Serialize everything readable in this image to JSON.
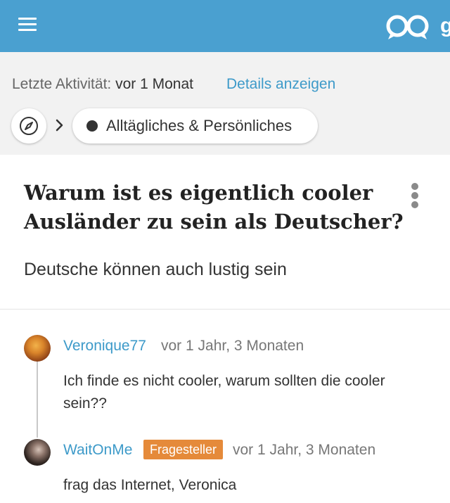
{
  "icons": {
    "menu": "hamburger-icon",
    "logo": "gutefrage-logo",
    "compass": "compass-icon",
    "separator": "chevron-right-icon",
    "category_dot": "dot-icon",
    "more": "more-vertical-icon"
  },
  "colors": {
    "header": "#4aa0d0",
    "link": "#3d9ac9",
    "badge": "#e58a3a",
    "meta_background": "#f2f2f2"
  },
  "header": {
    "logo_text": "g"
  },
  "meta": {
    "activity_label": "Letzte Aktivität:",
    "activity_value": "vor 1 Monat",
    "details_link": "Details anzeigen"
  },
  "breadcrumb": {
    "category": "Alltägliches & Persönliches"
  },
  "question": {
    "title": "Warum ist es eigentlich cooler Ausländer zu sein als Deutscher?",
    "body": "Deutsche können auch lustig sein"
  },
  "comments": [
    {
      "author": "Veronique77",
      "time": "vor 1 Jahr, 3 Monaten",
      "text": "Ich finde es nicht cooler, warum sollten die cooler sein??"
    },
    {
      "author": "WaitOnMe",
      "badge": "Fragesteller",
      "time": "vor 1 Jahr, 3 Monaten",
      "text": "frag das Internet, Veronica"
    }
  ]
}
